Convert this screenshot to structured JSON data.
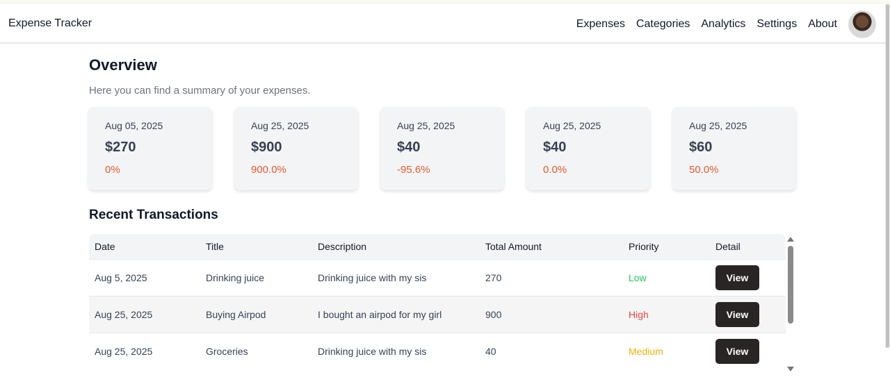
{
  "app": {
    "title": "Expense Tracker"
  },
  "nav": {
    "items": [
      "Expenses",
      "Categories",
      "Analytics",
      "Settings",
      "About"
    ]
  },
  "overview": {
    "title": "Overview",
    "subtitle": "Here you can find a summary of your expenses.",
    "cards": [
      {
        "date": "Aug 05, 2025",
        "amount": "$270",
        "change": "0%"
      },
      {
        "date": "Aug 25, 2025",
        "amount": "$900",
        "change": "900.0%"
      },
      {
        "date": "Aug 25, 2025",
        "amount": "$40",
        "change": "-95.6%"
      },
      {
        "date": "Aug 25, 2025",
        "amount": "$40",
        "change": "0.0%"
      },
      {
        "date": "Aug 25, 2025",
        "amount": "$60",
        "change": "50.0%"
      }
    ]
  },
  "transactions": {
    "title": "Recent Transactions",
    "headers": [
      "Date",
      "Title",
      "Description",
      "Total Amount",
      "Priority",
      "Detail"
    ],
    "rows": [
      {
        "date": "Aug 5, 2025",
        "title": "Drinking juice",
        "description": "Drinking juice with my sis",
        "amount": "270",
        "priority": "Low",
        "action": "View"
      },
      {
        "date": "Aug 25, 2025",
        "title": "Buying Airpod",
        "description": "I bought an airpod for my girl",
        "amount": "900",
        "priority": "High",
        "action": "View"
      },
      {
        "date": "Aug 25, 2025",
        "title": "Groceries",
        "description": "Drinking juice with my sis",
        "amount": "40",
        "priority": "Medium",
        "action": "View"
      }
    ]
  },
  "colors": {
    "change_text": "#e85a2a",
    "priority_low": "#22c55e",
    "priority_high": "#ef4444",
    "priority_medium": "#eab308",
    "button_bg": "#292524"
  },
  "icons": {
    "avatar": "user-avatar",
    "scroll_up": "triangle-up-icon",
    "scroll_down": "triangle-down-icon"
  }
}
